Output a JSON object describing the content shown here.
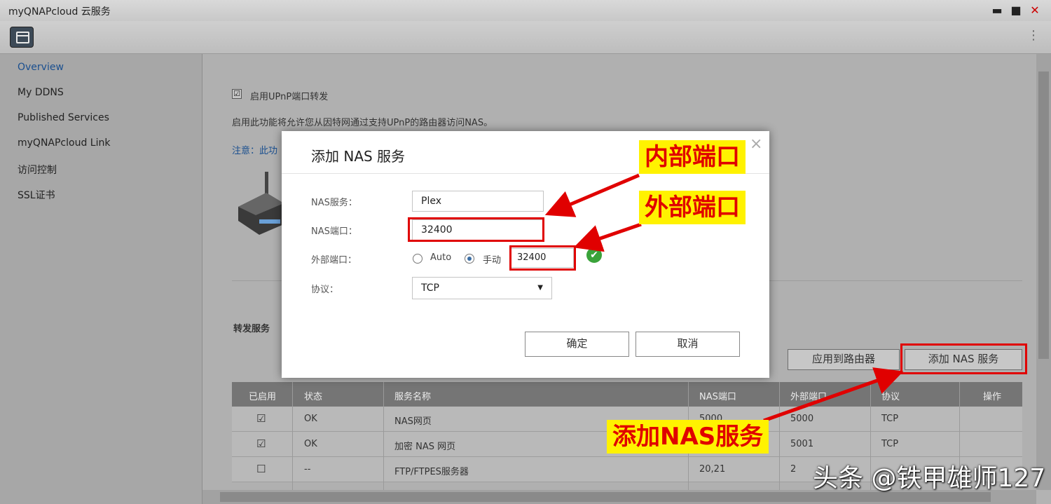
{
  "window": {
    "title": "myQNAPcloud 云服务",
    "minimize": "▬",
    "maximize": "■",
    "close": "✕"
  },
  "sidebar": {
    "items": [
      {
        "label": "Overview"
      },
      {
        "label": "My DDNS"
      },
      {
        "label": "Published Services"
      },
      {
        "label": "myQNAPcloud Link"
      },
      {
        "label": "访问控制"
      },
      {
        "label": "SSL证书"
      }
    ]
  },
  "main": {
    "upnp_checkbox_mark": "☑",
    "upnp_label": "启用UPnP端口转发",
    "upnp_desc": "启用此功能将允许您从因特网通过支持UPnP的路由器访问NAS。",
    "note": "注意：此功",
    "forward_title": "转发服务",
    "apply_router_btn": "应用到路由器",
    "add_nas_btn": "添加 NAS 服务"
  },
  "table": {
    "headers": [
      "已启用",
      "状态",
      "服务名称",
      "NAS端口",
      "外部端口",
      "协议",
      "操作"
    ],
    "rows": [
      {
        "enabled": "☑",
        "status": "OK",
        "name": "NAS网页",
        "nas_port": "5000",
        "ext_port": "5000",
        "protocol": "TCP"
      },
      {
        "enabled": "☑",
        "status": "OK",
        "name": "加密 NAS 网页",
        "nas_port": "",
        "ext_port": "5001",
        "protocol": "TCP"
      },
      {
        "enabled": "☐",
        "status": "--",
        "name": "FTP/FTPES服务器",
        "nas_port": "20,21",
        "ext_port": "2",
        "protocol": ""
      }
    ]
  },
  "dialog": {
    "title": "添加 NAS 服务",
    "close": "×",
    "service_label": "NAS服务：",
    "service_value": "Plex",
    "nas_port_label": "NAS端口：",
    "nas_port_value": "32400",
    "ext_port_label": "外部端口：",
    "auto_label": "Auto",
    "manual_label": "手动",
    "ext_port_value": "32400",
    "protocol_label": "协议：",
    "protocol_value": "TCP",
    "ok_btn": "确定",
    "cancel_btn": "取消"
  },
  "annotations": {
    "internal_port": "内部端口",
    "external_port": "外部端口",
    "add_service": "添加NAS服务",
    "accent_color": "#e00000",
    "callout_bg": "#fff200"
  },
  "watermark": "头条 @铁甲雄师127"
}
